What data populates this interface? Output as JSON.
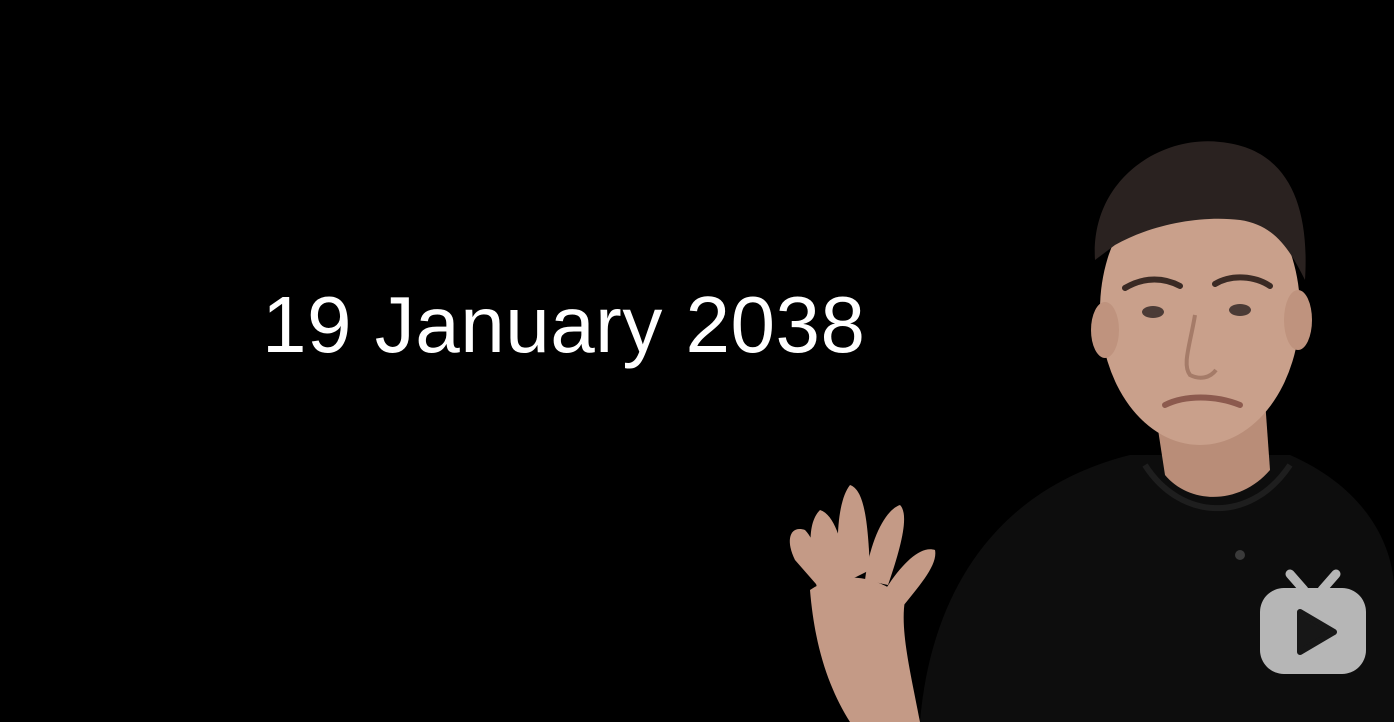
{
  "slide": {
    "caption": "19 January 2038"
  },
  "colors": {
    "background": "#000000",
    "caption_text": "#ffffff",
    "skin": "#c9a08b",
    "hair": "#2a2220",
    "shirt": "#0d0d0d",
    "watermark": "#e6e6e6"
  },
  "icons": {
    "watermark": "tv-play-icon"
  }
}
